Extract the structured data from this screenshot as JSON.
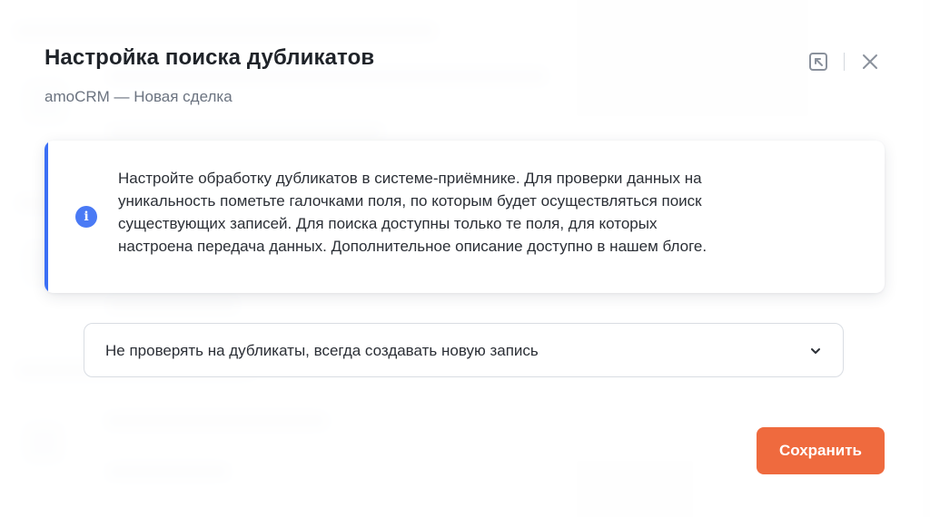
{
  "dialog": {
    "title": "Настройка поиска дубликатов",
    "subtitle": "amoCRM — Новая сделка"
  },
  "header_actions": {
    "icons": [
      "open-in-new-icon",
      "close-icon"
    ]
  },
  "info": {
    "icon": "info-icon",
    "icon_glyph": "i",
    "accent_color": "#3b6ff5",
    "lines": [
      "Настройте обработку дубликатов в системе-приёмнике. Для проверки данных на",
      "уникальность пометьте галочками поля, по которым будет осуществляться поиск",
      "существующих записей. Для поиска доступны только те поля, для которых",
      "настроена передача данных. Дополнительное описание доступно в нашем блоге."
    ]
  },
  "duplicate_mode": {
    "selected": "Не проверять на дубликаты, всегда создавать новую запись",
    "icon": "chevron-down-icon"
  },
  "actions": {
    "save_label": "Сохранить",
    "save_color": "#ef6a3e"
  }
}
